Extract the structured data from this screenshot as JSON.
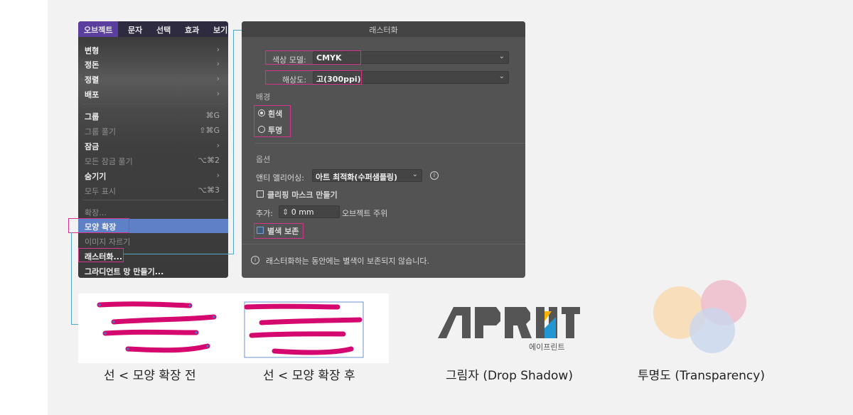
{
  "menubar": {
    "items": [
      "오브젝트",
      "문자",
      "선택",
      "효과",
      "보기"
    ]
  },
  "menu": {
    "items": [
      {
        "label": "변형",
        "shortcut": "›"
      },
      {
        "label": "정돈",
        "shortcut": "›"
      },
      {
        "label": "정렬",
        "shortcut": "›"
      },
      {
        "label": "배포",
        "shortcut": "›"
      },
      {
        "label": "그룹",
        "shortcut": "⌘G"
      },
      {
        "label": "그룹 풀기",
        "shortcut": "⇧⌘G"
      },
      {
        "label": "잠금",
        "shortcut": "›"
      },
      {
        "label": "모든 잠금 풀기",
        "shortcut": "⌥⌘2"
      },
      {
        "label": "숨기기",
        "shortcut": "›"
      },
      {
        "label": "모두 표시",
        "shortcut": "⌥⌘3"
      },
      {
        "label": "확장...",
        "shortcut": ""
      },
      {
        "label": "모양 확장",
        "shortcut": ""
      },
      {
        "label": "이미지 자르기",
        "shortcut": ""
      },
      {
        "label": "래스터화...",
        "shortcut": ""
      },
      {
        "label": "그라디언트 망 만들기...",
        "shortcut": ""
      }
    ]
  },
  "dialog": {
    "title": "래스터화",
    "color_model_label": "색상 모델:",
    "color_model_value": "CMYK",
    "resolution_label": "해상도:",
    "resolution_value": "고(300ppi)",
    "background_label": "배경",
    "bg_white": "흰색",
    "bg_transparent": "투명",
    "options_label": "옵션",
    "antialias_label": "앤티 앨리어싱:",
    "antialias_value": "아트 최적화(수퍼샘플링)",
    "clipping_mask": "클리핑 마스크 만들기",
    "add_label": "추가:",
    "add_value": "0 mm",
    "add_suffix": "오브젝트 주위",
    "preserve_spot": "별색 보존",
    "info": "래스터화하는 동안에는 별색이 보존되지 않습니다."
  },
  "captions": {
    "before": "선 < 모양 확장 전",
    "after": "선 < 모양 확장 후",
    "shadow": "그림자 (Drop Shadow)",
    "transparency": "투명도 (Transparency)"
  },
  "logo": {
    "text": "APRINT",
    "sub": "에이프린트"
  },
  "colors": {
    "stroke": "#d4086f",
    "highlight": "#d6338a",
    "menu_select": "#5d80c6",
    "circle_orange": "#f9dcb6",
    "circle_pink": "#eebdcd",
    "circle_blue": "#c9d6ee"
  }
}
